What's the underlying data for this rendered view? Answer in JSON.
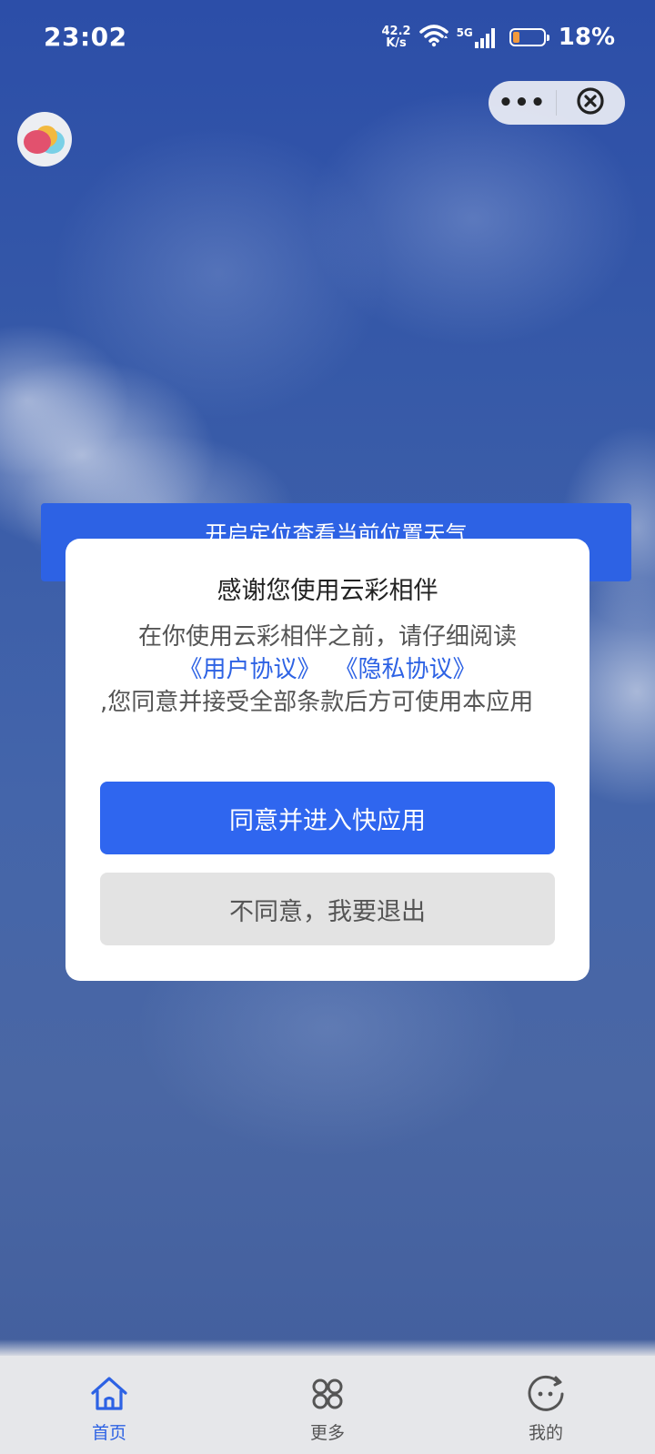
{
  "status_bar": {
    "time": "23:02",
    "net_speed_value": "42.2",
    "net_speed_unit": "K/s",
    "network_type": "5G",
    "battery_percent": "18%",
    "battery_level": 0.18
  },
  "capsule": {
    "more_label": "•••"
  },
  "banner": {
    "text": "开启定位查看当前位置天气"
  },
  "dialog": {
    "title": "感谢您使用云彩相伴",
    "intro": "在你使用云彩相伴之前，请仔细阅读",
    "user_agreement_link": "《用户协议》",
    "privacy_link": "《隐私协议》",
    "body": ",您同意并接受全部条款后方可使用本应用",
    "agree_button": "同意并进入快应用",
    "exit_button": "不同意，我要退出"
  },
  "bottom_nav": {
    "items": [
      {
        "label": "首页",
        "icon": "home-icon",
        "active": true
      },
      {
        "label": "更多",
        "icon": "grid-icon",
        "active": false
      },
      {
        "label": "我的",
        "icon": "profile-face-icon",
        "active": false
      }
    ]
  },
  "colors": {
    "accent": "#2d62e4",
    "agree_button": "#2f66ef",
    "exit_button": "#e3e3e3"
  }
}
